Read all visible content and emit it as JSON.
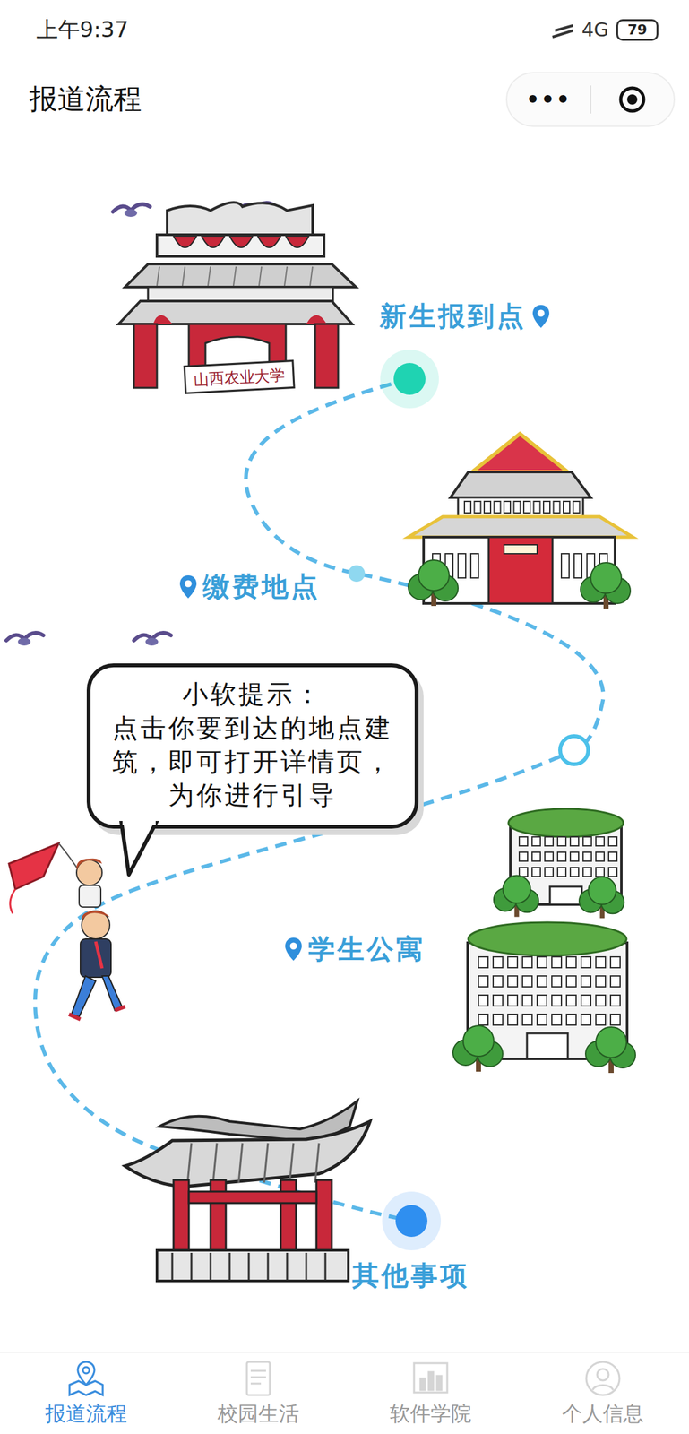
{
  "status_bar": {
    "time": "上午9:37",
    "network": "4G",
    "battery": "79"
  },
  "title_bar": {
    "title": "报道流程",
    "menu": "•••"
  },
  "map": {
    "gate_sign": "山西农业大学",
    "stops": [
      {
        "label": "新生报到点",
        "kind": "glow",
        "color": "#1fd3b2"
      },
      {
        "label": "缴费地点",
        "kind": "dot",
        "color": "#8fd8f0"
      },
      {
        "label": "学生公寓",
        "kind": "ring",
        "color": "#4cc1ea"
      },
      {
        "label": "其他事项",
        "kind": "glow",
        "color": "#2f8ff0"
      }
    ],
    "tip": {
      "title": "小软提示：",
      "body": "点击你要到达的地点建筑，即可打开详情页，为你进行引导"
    }
  },
  "tabs": [
    {
      "label": "报道流程",
      "selected": true
    },
    {
      "label": "校园生活",
      "selected": false
    },
    {
      "label": "软件学院",
      "selected": false
    },
    {
      "label": "个人信息",
      "selected": false
    }
  ]
}
